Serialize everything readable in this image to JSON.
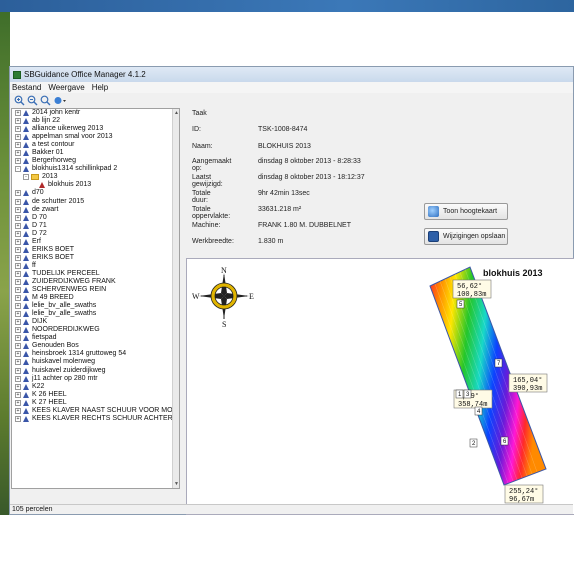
{
  "window": {
    "title": "SBGuidance Office Manager 4.1.2"
  },
  "menu": [
    "Bestand",
    "Weergave",
    "Help"
  ],
  "toolbar": {
    "icons": [
      "zoom-in-icon",
      "zoom-out-icon",
      "zoom-fit-icon",
      "globe-icon"
    ]
  },
  "tree": {
    "items": [
      {
        "label": "2014 john kentr",
        "icon": "node",
        "level": 0,
        "exp": "+"
      },
      {
        "label": "ab lijn 22",
        "icon": "node",
        "level": 0,
        "exp": "+"
      },
      {
        "label": "alliance uikerweg 2013",
        "icon": "node",
        "level": 0,
        "exp": "+"
      },
      {
        "label": "appelman smal voor 2013",
        "icon": "node",
        "level": 0,
        "exp": "+"
      },
      {
        "label": "a test contour",
        "icon": "node",
        "level": 0,
        "exp": "+"
      },
      {
        "label": "Bakker 01",
        "icon": "node",
        "level": 0,
        "exp": "+"
      },
      {
        "label": "Bergerhorweg",
        "icon": "node",
        "level": 0,
        "exp": "+"
      },
      {
        "label": "blokhuis1314 schillinkpad 2",
        "icon": "node",
        "level": 0,
        "exp": "-"
      },
      {
        "label": "2013",
        "icon": "folder",
        "level": 1,
        "exp": "-"
      },
      {
        "label": "blokhuis 2013",
        "icon": "red",
        "level": 2,
        "exp": ""
      },
      {
        "label": "d70",
        "icon": "node",
        "level": 0,
        "exp": "+"
      },
      {
        "label": "de schutter 2015",
        "icon": "node",
        "level": 0,
        "exp": "+"
      },
      {
        "label": "de zwart",
        "icon": "node",
        "level": 0,
        "exp": "+"
      },
      {
        "label": "D 70",
        "icon": "node",
        "level": 0,
        "exp": "+"
      },
      {
        "label": "D 71",
        "icon": "node",
        "level": 0,
        "exp": "+"
      },
      {
        "label": "D 72",
        "icon": "node",
        "level": 0,
        "exp": "+"
      },
      {
        "label": "Erf",
        "icon": "node",
        "level": 0,
        "exp": "+"
      },
      {
        "label": "ERIKS BOET",
        "icon": "node",
        "level": 0,
        "exp": "+"
      },
      {
        "label": "ERIKS BOET",
        "icon": "node",
        "level": 0,
        "exp": "+"
      },
      {
        "label": "ff",
        "icon": "node",
        "level": 0,
        "exp": "+"
      },
      {
        "label": "TUDELIJK PERCEEL",
        "icon": "node",
        "level": 0,
        "exp": "+"
      },
      {
        "label": "ZUIDERDIJKWEG FRANK",
        "icon": "node",
        "level": 0,
        "exp": "+"
      },
      {
        "label": "SCHERVENWEG REIN",
        "icon": "node",
        "level": 0,
        "exp": "+"
      },
      {
        "label": "M 49 BREED",
        "icon": "node",
        "level": 0,
        "exp": "+"
      },
      {
        "label": "lelie_bv_alle_swaths",
        "icon": "node",
        "level": 0,
        "exp": "+"
      },
      {
        "label": "lelie_bv_alle_swaths",
        "icon": "node",
        "level": 0,
        "exp": "+"
      },
      {
        "label": "DIJK",
        "icon": "node",
        "level": 0,
        "exp": "+"
      },
      {
        "label": "NOORDERDIJKWEG",
        "icon": "node",
        "level": 0,
        "exp": "+"
      },
      {
        "label": "fietspad",
        "icon": "node",
        "level": 0,
        "exp": "+"
      },
      {
        "label": "Genouden Bos",
        "icon": "node",
        "level": 0,
        "exp": "+"
      },
      {
        "label": "heinsbroek 1314 gruttoweg 54",
        "icon": "node",
        "level": 0,
        "exp": "+"
      },
      {
        "label": "huiskavel molenweg",
        "icon": "node",
        "level": 0,
        "exp": "+"
      },
      {
        "label": "huiskavel zuiderdijkweg",
        "icon": "node",
        "level": 0,
        "exp": "+"
      },
      {
        "label": "j11 achter op  280 mtr",
        "icon": "node",
        "level": 0,
        "exp": "+"
      },
      {
        "label": "K22",
        "icon": "node",
        "level": 0,
        "exp": "+"
      },
      {
        "label": "K 26 HEEL",
        "icon": "node",
        "level": 0,
        "exp": "+"
      },
      {
        "label": "K 27 HEEL",
        "icon": "node",
        "level": 0,
        "exp": "+"
      },
      {
        "label": "KEES KLAVER NAAST SCHUUR  VOOR MO",
        "icon": "node",
        "level": 0,
        "exp": "+"
      },
      {
        "label": "KEES KLAVER RECHTS SCHUUR ACHTER",
        "icon": "node",
        "level": 0,
        "exp": "+"
      }
    ]
  },
  "details": {
    "section": "Taak",
    "id_label": "ID:",
    "id_value": "TSK-1008-8474",
    "name_label": "Naam:",
    "name_value": "BLOKHUIS 2013",
    "created_label": "Aangemaakt op:",
    "created_value": "dinsdag 8 oktober 2013 - 8:28:33",
    "modified_label": "Laatst gewijzigd:",
    "modified_value": "dinsdag 8 oktober 2013 - 18:12:37",
    "duration_label": "Totale duur:",
    "duration_value": "9hr 42min 13sec",
    "area_label": "Totale oppervlakte:",
    "area_value": "33631.218 m²",
    "machine_label": "Machine:",
    "machine_value": "FRANK 1.80 M. DUBBELNET",
    "width_label": "Werkbreedte:",
    "width_value": "1.830 m"
  },
  "buttons": {
    "height_map": "Toon hoogtekaart",
    "save_changes": "Wijzigingen opslaan"
  },
  "map": {
    "title": "blokhuis 2013",
    "compass": {
      "n": "N",
      "s": "S",
      "e": "E",
      "w": "W"
    },
    "labels": [
      {
        "a": "56,62°",
        "b": "100,83m"
      },
      {
        "a": "165,04°",
        "b": "390,93m"
      },
      {
        "a": "4,19°",
        "b": "358,74m"
      },
      {
        "a": "255,24°",
        "b": "96,67m"
      }
    ],
    "markers": [
      "5",
      "7",
      "1",
      "3",
      "4",
      "2",
      "6"
    ]
  },
  "status": {
    "text": "105 percelen"
  },
  "colors": {
    "accent": "#2c5f9a",
    "window_bg": "#f0f0f0"
  }
}
